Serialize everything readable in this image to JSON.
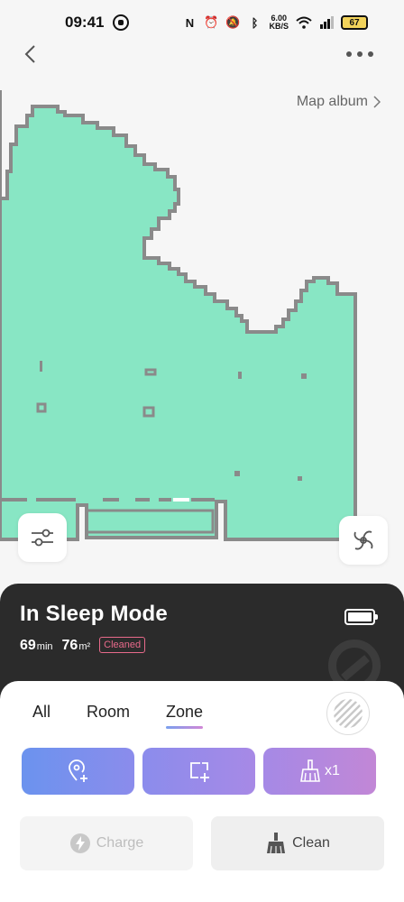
{
  "status_bar": {
    "time": "09:41",
    "network_speed_value": "6.00",
    "network_speed_unit": "KB/S",
    "battery_level": "67"
  },
  "header": {
    "map_album_label": "Map album"
  },
  "robot": {
    "state": "In Sleep Mode",
    "duration_value": "69",
    "duration_unit": "min",
    "area_value": "76",
    "area_unit": "m²",
    "status_badge": "Cleaned",
    "battery_fill": 1.0
  },
  "tabs": [
    {
      "label": "All"
    },
    {
      "label": "Room"
    },
    {
      "label": "Zone"
    }
  ],
  "active_tab": "Zone",
  "modes": {
    "repeat_label": "x1"
  },
  "actions": {
    "charge_label": "Charge",
    "clean_label": "Clean"
  },
  "colors": {
    "map_fill": "#88e6c4",
    "map_wall": "#8a8a8a",
    "panel_bg": "#2b2b2b",
    "badge": "#e86a8b",
    "accent_start": "#6b93ee",
    "accent_end": "#c287d6"
  },
  "icons": {
    "back": "chevron-left-icon",
    "more": "more-dots-icon",
    "album_arrow": "chevron-right-icon",
    "settings": "sliders-icon",
    "suction": "fan-icon",
    "battery": "battery-icon",
    "hatch": "hatch-pattern-icon",
    "pin": "location-pin-icon",
    "zone": "add-zone-icon",
    "broom": "broom-icon",
    "charge": "lightning-icon",
    "clean": "broom-icon"
  }
}
